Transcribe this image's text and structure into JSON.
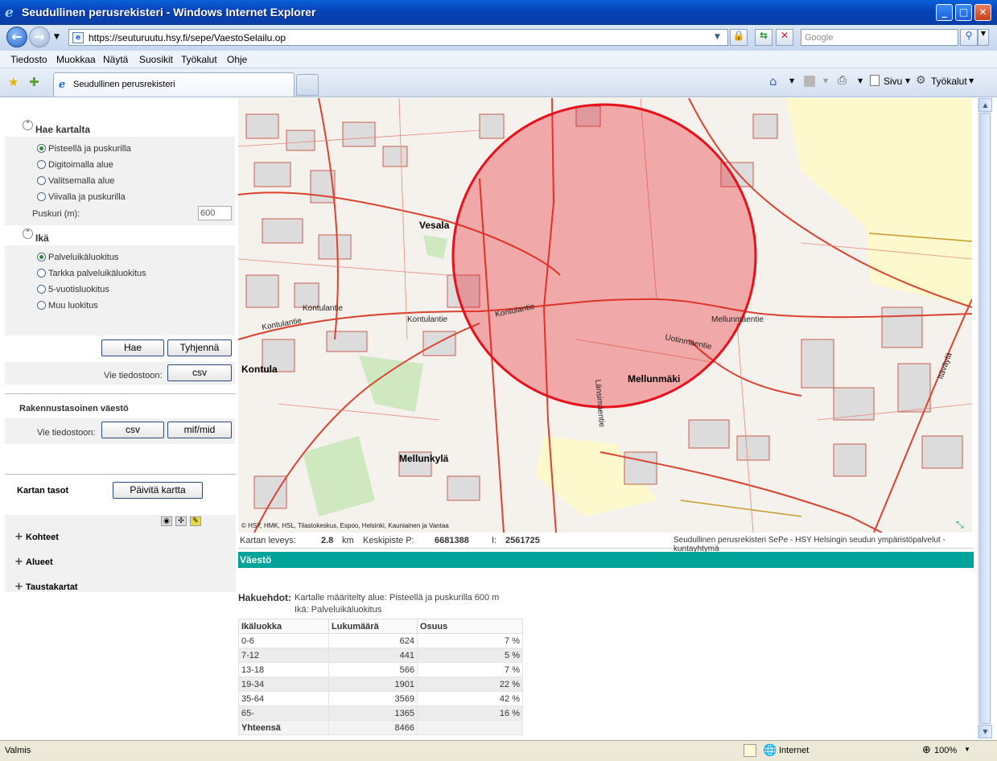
{
  "window": {
    "title": "Seudullinen perusrekisteri - Windows Internet Explorer"
  },
  "address": {
    "url": "https://seuturuutu.hsy.fi/sepe/VaestoSelailu.op",
    "search_placeholder": "Google"
  },
  "menu": [
    "Tiedosto",
    "Muokkaa",
    "Näytä",
    "Suosikit",
    "Työkalut",
    "Ohje"
  ],
  "tab": {
    "title": "Seudullinen perusrekisteri"
  },
  "commandbar": {
    "page": "Sivu",
    "tools": "Työkalut"
  },
  "left": {
    "search_title": "Hae kartalta",
    "search_options": [
      "Pisteellä ja puskurilla",
      "Digitoimalla alue",
      "Valitsemalla alue",
      "Viivalla ja puskurilla"
    ],
    "buffer_label": "Puskuri (m):",
    "buffer_value": "600",
    "age_title": "Ikä",
    "age_options": [
      "Palveluikäluokitus",
      "Tarkka palveluikäluokitus",
      "5-vuotisluokitus",
      "Muu luokitus"
    ],
    "btn_search": "Hae",
    "btn_clear": "Tyhjennä",
    "export_label": "Vie tiedostoon:",
    "btn_csv": "csv",
    "building_title": "Rakennustasoinen väestö",
    "export_label2": "Vie tiedostoon:",
    "btn_csv2": "csv",
    "btn_mif": "mif/mid",
    "layers_title": "Kartan tasot",
    "btn_refresh": "Päivitä kartta",
    "layers": [
      "Kohteet",
      "Alueet",
      "Taustakartat"
    ]
  },
  "map": {
    "labels": {
      "vesala": "Vesala",
      "kontula": "Kontula",
      "mellunmaki": "Mellunmäki",
      "mellunkyla": "Mellunkylä",
      "kontulantie1": "Kontulantie",
      "kontulantie2": "Kontulantie",
      "kontulantie3": "Kontulantie",
      "kontulantie4": "Kontulantie",
      "mellunmaentie": "Mellunmäentie",
      "lansimaentie": "Länsimäentie",
      "uotinmaentie": "Uotinmäentie",
      "itavayla": "Itäväylä",
      "copyright": "© HSY, HMK, HSL, Tilastokeskus, Espoo, Helsinki, Kauniainen ja Vantaa"
    }
  },
  "mapinfo": {
    "width_label": "Kartan leveys:",
    "width_value": "2.8",
    "width_unit": "km",
    "center_label": "Keskipiste P:",
    "p_value": "6681388",
    "i_label": "I:",
    "i_value": "2561725",
    "credit": "Seudullinen perusrekisteri SePe - HSY Helsingin seudun ympäristöpalvelut -kuntayhtymä"
  },
  "results": {
    "section": "Väestö",
    "criteria_label": "Hakuehdot:",
    "criteria_line1": "Kartalle määritelty alue: Pisteellä ja puskurilla 600 m",
    "criteria_line2": "Ikä: Palveluikäluokitus",
    "columns": [
      "Ikäluokka",
      "Lukumäärä",
      "Osuus"
    ],
    "rows": [
      [
        "0-6",
        "624",
        "7 %"
      ],
      [
        "7-12",
        "441",
        "5 %"
      ],
      [
        "13-18",
        "566",
        "7 %"
      ],
      [
        "19-34",
        "1901",
        "22 %"
      ],
      [
        "35-64",
        "3569",
        "42 %"
      ],
      [
        "65-",
        "1365",
        "16 %"
      ]
    ],
    "total_label": "Yhteensä",
    "total_value": "8466"
  },
  "status": {
    "left": "Valmis",
    "zone": "Internet",
    "zoom": "100%"
  },
  "colors": {
    "accent": "#00a39a",
    "buffer": "#e8111b",
    "titlebar": "#0842b8"
  }
}
